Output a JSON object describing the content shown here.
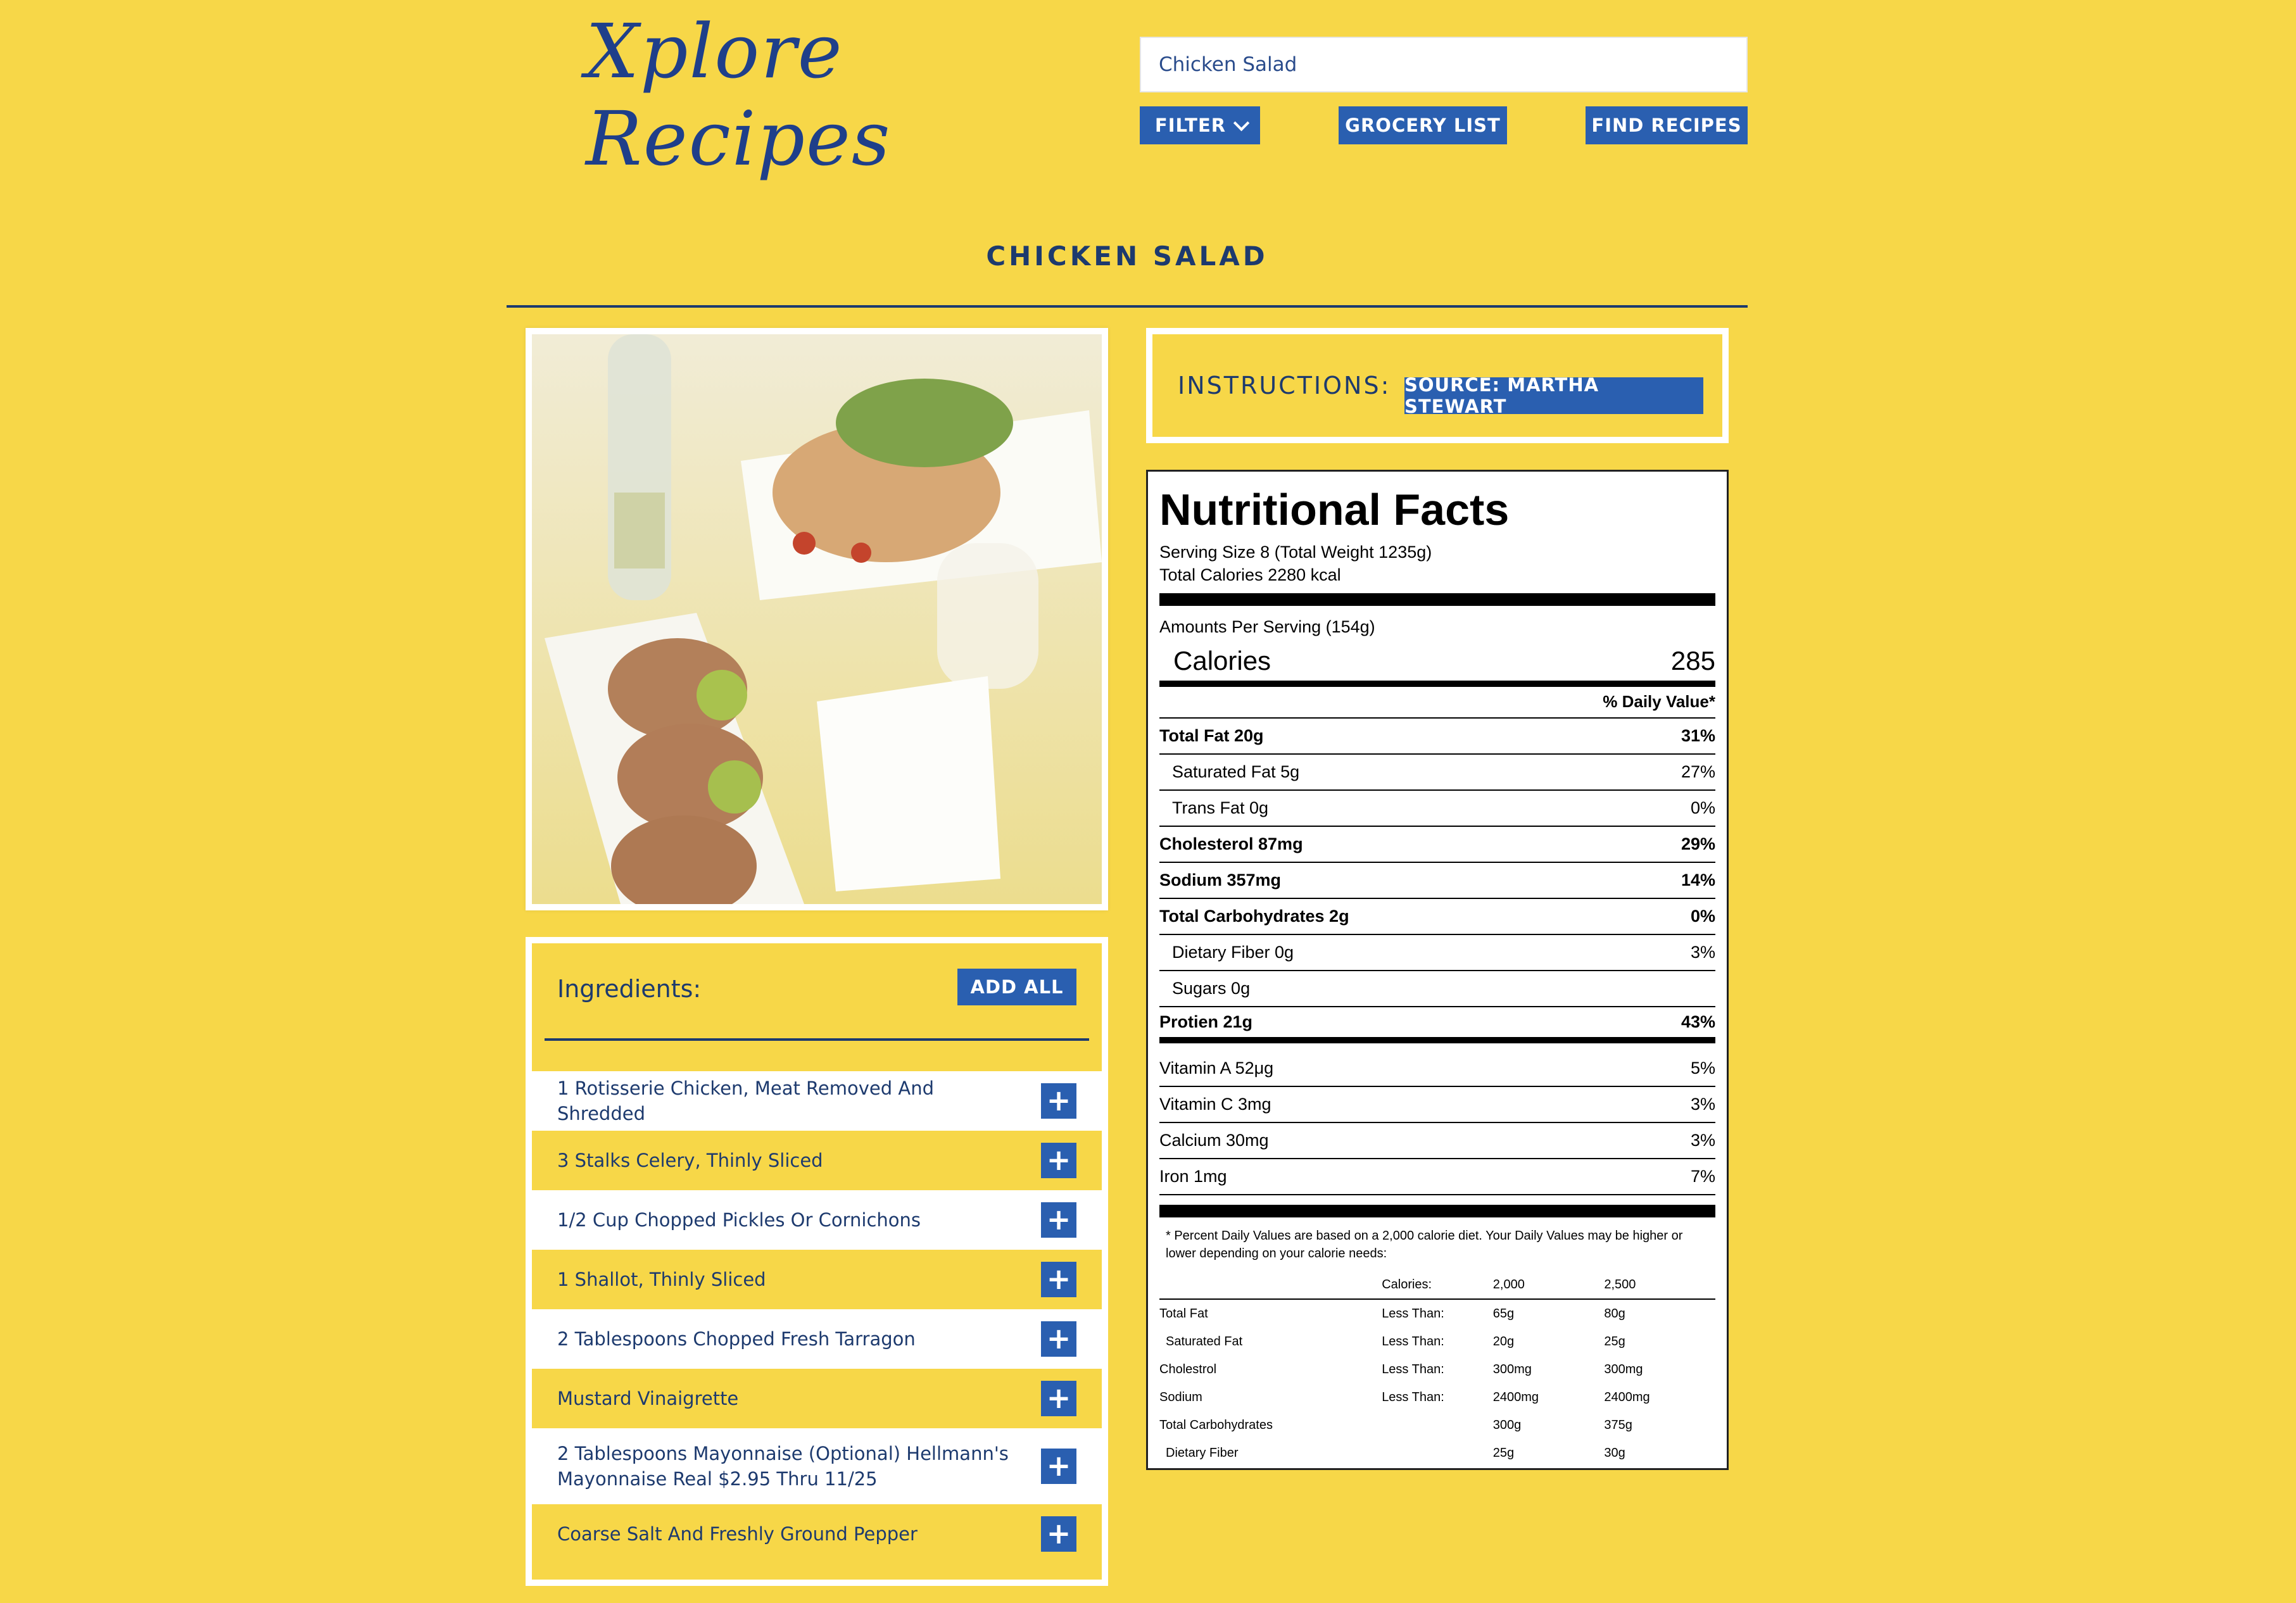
{
  "header": {
    "logo": "Xplore Recipes",
    "search_value": "Chicken Salad",
    "filter_label": "FILTER",
    "grocery_label": "GROCERY LIST",
    "find_label": "FIND RECIPES"
  },
  "recipe": {
    "title": "CHICKEN SALAD",
    "instructions_label": "INSTRUCTIONS:",
    "source_label": "SOURCE: MARTHA STEWART"
  },
  "ingredients": {
    "label": "Ingredients:",
    "add_all_label": "ADD ALL",
    "items": [
      {
        "text": "1 Rotisserie Chicken, Meat Removed And Shredded"
      },
      {
        "text": "3 Stalks Celery, Thinly Sliced"
      },
      {
        "text": "1/2 Cup Chopped Pickles Or Cornichons"
      },
      {
        "text": "1 Shallot, Thinly Sliced"
      },
      {
        "text": "2 Tablespoons Chopped Fresh Tarragon"
      },
      {
        "text": "Mustard Vinaigrette"
      },
      {
        "text": "2 Tablespoons Mayonnaise (Optional) Hellmann's Mayonnaise Real $2.95 Thru 11/25"
      },
      {
        "text": "Coarse Salt And Freshly Ground Pepper"
      }
    ]
  },
  "nutrition": {
    "heading": "Nutritional Facts",
    "serving_size": "Serving Size 8 (Total Weight 1235g)",
    "total_calories": "Total Calories 2280 kcal",
    "amount_per_serving": "Amounts Per Serving (154g)",
    "calories_label": "Calories",
    "calories_value": "285",
    "dv_header": "% Daily Value*",
    "rows": [
      {
        "label": "Total Fat 20g",
        "value": "31%",
        "bold": true,
        "indent": false
      },
      {
        "label": "Saturated Fat 5g",
        "value": "27%",
        "bold": false,
        "indent": true
      },
      {
        "label": "Trans Fat 0g",
        "value": "0%",
        "bold": false,
        "indent": true
      },
      {
        "label": "Cholesterol 87mg",
        "value": "29%",
        "bold": true,
        "indent": false
      },
      {
        "label": "Sodium 357mg",
        "value": "14%",
        "bold": true,
        "indent": false
      },
      {
        "label": "Total Carbohydrates 2g",
        "value": "0%",
        "bold": true,
        "indent": false
      },
      {
        "label": "Dietary Fiber 0g",
        "value": "3%",
        "bold": false,
        "indent": true
      },
      {
        "label": "Sugars 0g",
        "value": "",
        "bold": false,
        "indent": true
      },
      {
        "label": "Protien 21g",
        "value": "43%",
        "bold": true,
        "indent": false
      }
    ],
    "vitamins": [
      {
        "label": "Vitamin A 52μg",
        "value": "5%"
      },
      {
        "label": "Vitamin C 3mg",
        "value": "3%"
      },
      {
        "label": "Calcium 30mg",
        "value": "3%"
      },
      {
        "label": "Iron 1mg",
        "value": "7%"
      }
    ],
    "footnote": "* Percent Daily Values are based on a 2,000 calorie diet. Your Daily Values may be higher or lower depending on your calorie needs:",
    "dv_table": {
      "head": [
        "",
        "Calories:",
        "2,000",
        "2,500"
      ],
      "rows": [
        [
          "Total Fat",
          "Less Than:",
          "65g",
          "80g"
        ],
        [
          " Saturated Fat",
          "Less Than:",
          "20g",
          "25g"
        ],
        [
          "Cholestrol",
          "Less Than:",
          "300mg",
          "300mg"
        ],
        [
          "Sodium",
          "Less Than:",
          "2400mg",
          "2400mg"
        ],
        [
          "Total Carbohydrates",
          "",
          "300g",
          "375g"
        ],
        [
          " Dietary Fiber",
          "",
          "25g",
          "30g"
        ]
      ]
    }
  },
  "colors": {
    "background": "#f7d748",
    "button": "#2a5fb0",
    "navy_text": "#1d3a6e"
  },
  "icons": {
    "filter_chevron": "chevron-down-icon",
    "add_item": "plus-icon"
  }
}
